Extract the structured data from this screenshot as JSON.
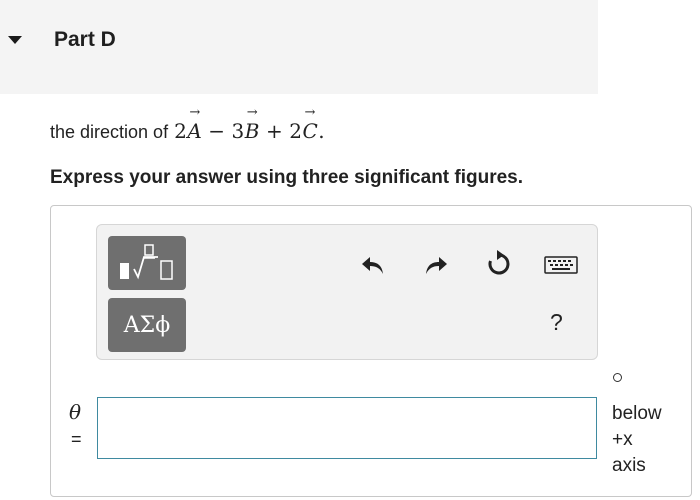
{
  "part": {
    "title": "Part D"
  },
  "question": {
    "prefix": "the direction of",
    "expr": [
      {
        "coef": "2",
        "var": "A",
        "op": "−"
      },
      {
        "coef": "3",
        "var": "B",
        "op": "+"
      },
      {
        "coef": "2",
        "var": "C",
        "op": ""
      }
    ],
    "suffix": "."
  },
  "instruction": "Express your answer using three significant figures.",
  "toolbar": {
    "template_icon": "fraction-sqrt-template-icon",
    "greek_label": "ΑΣϕ",
    "undo_icon": "undo-icon",
    "redo_icon": "redo-icon",
    "reset_icon": "reset-icon",
    "keyboard_icon": "keyboard-icon",
    "help_label": "?"
  },
  "answer": {
    "variable": "θ",
    "equals": "=",
    "value": "",
    "placeholder": "",
    "degree_symbol": "∘",
    "unit_lines": [
      "below",
      "+x",
      "axis"
    ]
  }
}
